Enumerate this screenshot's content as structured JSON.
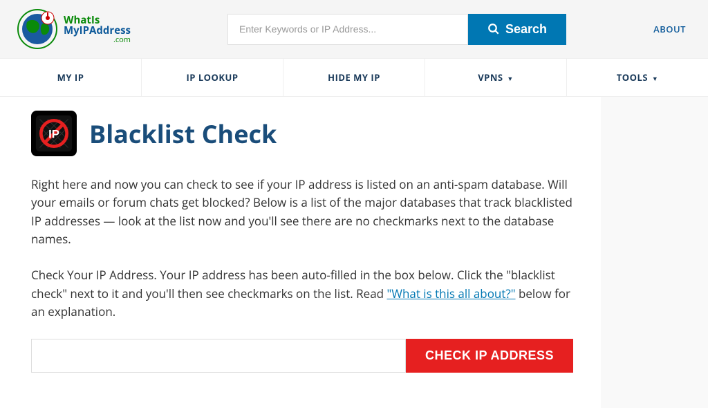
{
  "logo": {
    "line1": "WhatIs",
    "line2": "MyIPAddress",
    "line3": ".com"
  },
  "search": {
    "placeholder": "Enter Keywords or IP Address...",
    "button": "Search"
  },
  "header": {
    "about": "ABOUT"
  },
  "nav": {
    "myip": "MY IP",
    "iplookup": "IP LOOKUP",
    "hidemyip": "HIDE MY IP",
    "vpns": "VPNS",
    "tools": "TOOLS"
  },
  "page": {
    "title": "Blacklist Check",
    "para1": "Right here and now you can check to see if your IP address is listed on an anti-spam database. Will your emails or forum chats get blocked? Below is a list of the major databases that track blacklisted IP addresses — look at the list now and you'll see there are no checkmarks next to the database names.",
    "para2a": "Check Your IP Address. Your IP address has been auto-filled in the box below. Click the \"blacklist check\" next to it and you'll then see checkmarks on the list. Read ",
    "para2link": "\"What is this all about?\"",
    "para2b": " below for an explanation."
  },
  "check": {
    "value": "",
    "button": "CHECK IP ADDRESS"
  }
}
